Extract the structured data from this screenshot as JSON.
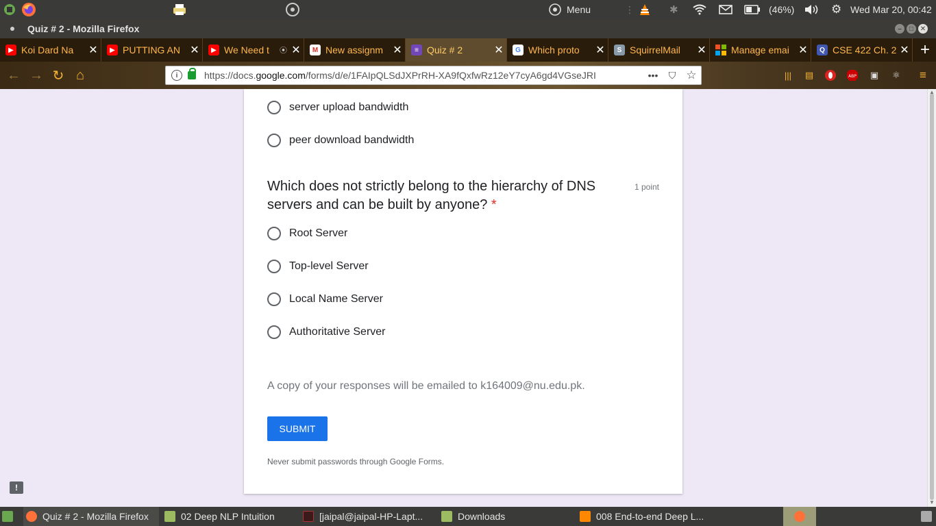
{
  "system_panel": {
    "menu_label": "Menu",
    "battery_percent": "(46%)",
    "datetime": "Wed Mar 20, 00:42"
  },
  "window": {
    "title": "Quiz # 2 - Mozilla Firefox"
  },
  "tabs": [
    {
      "label": "Koi Dard Na",
      "favicon": "youtube-icon",
      "color": "#ff0000"
    },
    {
      "label": "PUTTING AN",
      "favicon": "youtube-icon",
      "color": "#ff0000"
    },
    {
      "label": "We Need t",
      "favicon": "youtube-icon",
      "color": "#ff0000"
    },
    {
      "label": "New assignm",
      "favicon": "gmail-icon",
      "color": "#ffffff"
    },
    {
      "label": "Quiz # 2",
      "favicon": "google-forms-icon",
      "color": "#7248b9"
    },
    {
      "label": "Which proto",
      "favicon": "google-icon",
      "color": "#ffffff"
    },
    {
      "label": "SquirrelMail",
      "favicon": "squirrelmail-icon",
      "color": "#8899aa"
    },
    {
      "label": "Manage emai",
      "favicon": "microsoft-icon",
      "color": "#f25022"
    },
    {
      "label": "CSE 422 Ch. 2",
      "favicon": "quizlet-icon",
      "color": "#4257b2"
    }
  ],
  "urlbar": {
    "url_prefix": "https://docs.",
    "url_domain": "google.com",
    "url_rest": "/forms/d/e/1FAIpQLSdJXPrRH-XA9fQxfwRz12eY7cyA6gd4VGseJRI"
  },
  "form": {
    "prev_options": [
      "server upload bandwidth",
      "peer download bandwidth"
    ],
    "question": {
      "text": "Which does not strictly belong to the hierarchy of DNS servers and can be built by anyone?",
      "required_mark": "*",
      "points": "1 point",
      "options": [
        "Root Server",
        "Top-level Server",
        "Local Name Server",
        "Authoritative Server"
      ]
    },
    "copy_note": "A copy of your responses will be emailed to k164009@nu.edu.pk.",
    "submit_label": "SUBMIT",
    "never_note": "Never submit passwords through Google Forms."
  },
  "taskbar": {
    "items": [
      {
        "label": "Quiz # 2 - Mozilla Firefox",
        "icon": "firefox-icon"
      },
      {
        "label": "02 Deep NLP Intuition",
        "icon": "folder-icon"
      },
      {
        "label": "[jaipal@jaipal-HP-Lapt...",
        "icon": "terminal-icon"
      },
      {
        "label": "Downloads",
        "icon": "downloads-folder-icon"
      },
      {
        "label": "008 End-to-end Deep L...",
        "icon": "vlc-icon"
      }
    ]
  },
  "colors": {
    "accent": "#1a73e8",
    "page_bg": "#ede7f6",
    "required": "#d93025"
  }
}
